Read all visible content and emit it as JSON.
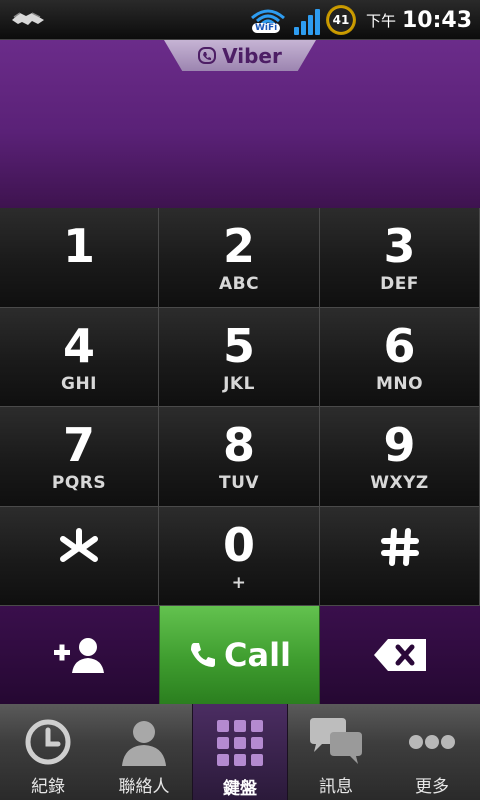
{
  "status_bar": {
    "wifi_label": "WiFi",
    "battery_level": "41",
    "time_prefix": "下午",
    "time": "10:43"
  },
  "header": {
    "brand": "Viber",
    "number": ""
  },
  "keypad": [
    {
      "digit": "1",
      "letters": ""
    },
    {
      "digit": "2",
      "letters": "ABC"
    },
    {
      "digit": "3",
      "letters": "DEF"
    },
    {
      "digit": "4",
      "letters": "GHI"
    },
    {
      "digit": "5",
      "letters": "JKL"
    },
    {
      "digit": "6",
      "letters": "MNO"
    },
    {
      "digit": "7",
      "letters": "PQRS"
    },
    {
      "digit": "8",
      "letters": "TUV"
    },
    {
      "digit": "9",
      "letters": "WXYZ"
    },
    {
      "digit": "",
      "letters": ""
    },
    {
      "digit": "0",
      "letters": "+"
    },
    {
      "digit": "",
      "letters": ""
    }
  ],
  "actions": {
    "call_label": "Call"
  },
  "tabs": [
    {
      "label": "紀錄",
      "icon": "clock-icon"
    },
    {
      "label": "聯絡人",
      "icon": "contact-icon"
    },
    {
      "label": "鍵盤",
      "icon": "keypad-icon",
      "active": true
    },
    {
      "label": "訊息",
      "icon": "chat-icon"
    },
    {
      "label": "更多",
      "icon": "more-icon"
    }
  ],
  "colors": {
    "brand_purple": "#5a2177",
    "call_green": "#3f9d2f",
    "signal_blue": "#2e9cf0"
  }
}
